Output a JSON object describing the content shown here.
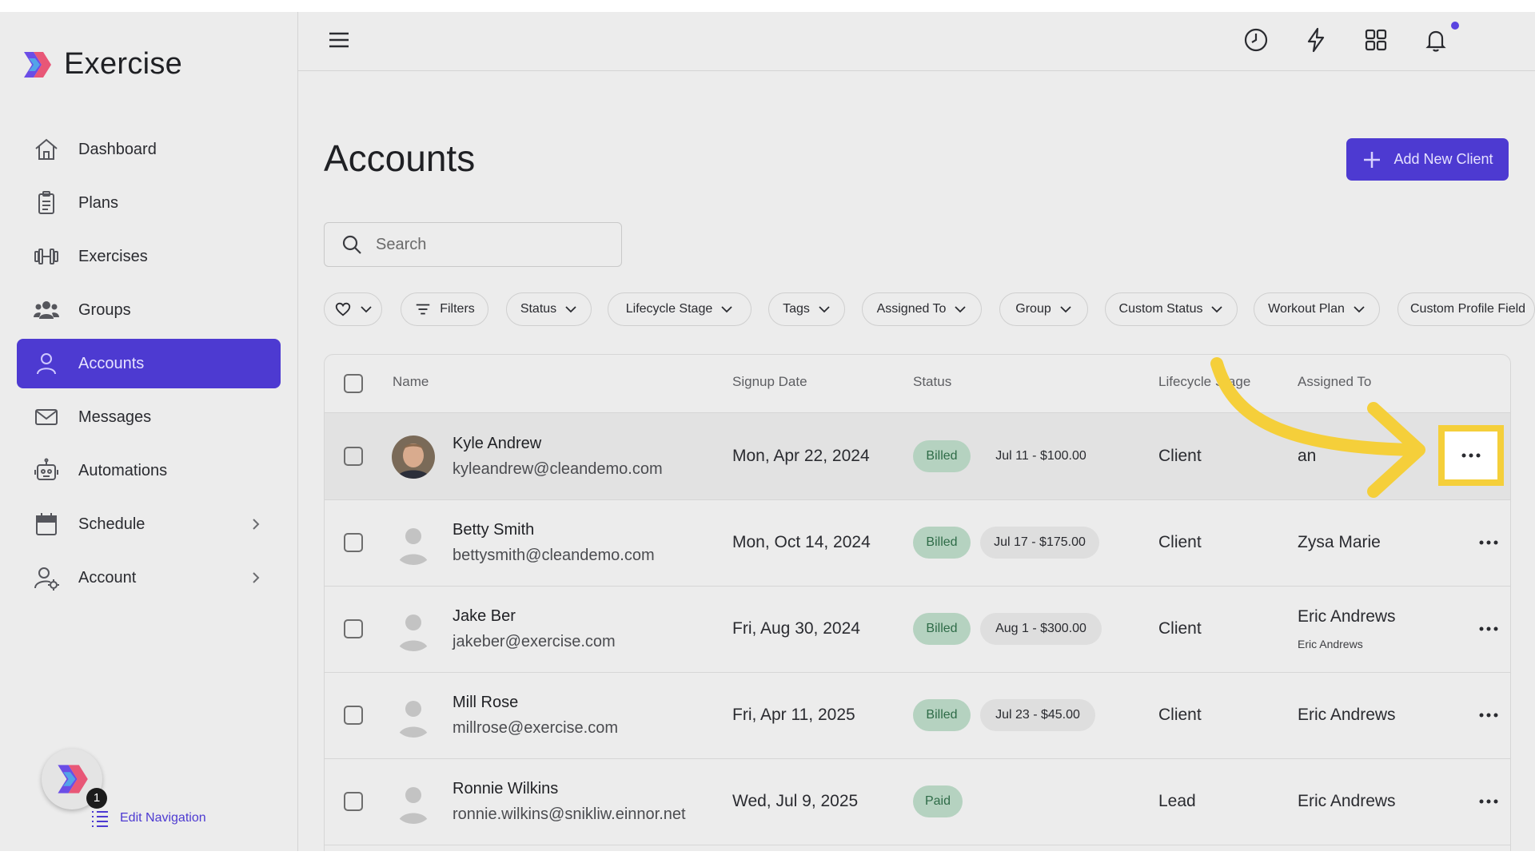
{
  "app": {
    "name": "Exercise"
  },
  "sidebar": {
    "items": [
      {
        "label": "Dashboard",
        "icon": "home-icon",
        "active": false
      },
      {
        "label": "Plans",
        "icon": "clipboard-icon",
        "active": false
      },
      {
        "label": "Exercises",
        "icon": "dumbbell-icon",
        "active": false
      },
      {
        "label": "Groups",
        "icon": "users-icon",
        "active": false
      },
      {
        "label": "Accounts",
        "icon": "user-icon",
        "active": true
      },
      {
        "label": "Messages",
        "icon": "mail-icon",
        "active": false
      },
      {
        "label": "Automations",
        "icon": "robot-icon",
        "active": false
      },
      {
        "label": "Schedule",
        "icon": "calendar-icon",
        "active": false,
        "expandable": true
      },
      {
        "label": "Account",
        "icon": "user-gear-icon",
        "active": false,
        "expandable": true
      }
    ],
    "helper_badge_count": "1",
    "edit_navigation_label": "Edit Navigation"
  },
  "topbar": {
    "icons": [
      "menu-icon",
      "clock-icon",
      "lightning-icon",
      "grid-icon",
      "bell-icon",
      "profile-avatar"
    ],
    "has_notification_dot": true
  },
  "main": {
    "title": "Accounts",
    "add_button_label": "Add New Client",
    "search_placeholder": "Search",
    "filters": [
      "Filters",
      "Status",
      "Lifecycle Stage",
      "Tags",
      "Assigned To",
      "Group",
      "Custom Status",
      "Workout Plan",
      "Custom Profile Field"
    ]
  },
  "table": {
    "columns": [
      "Name",
      "Signup Date",
      "Status",
      "Lifecycle Stage",
      "Assigned To"
    ],
    "rows": [
      {
        "name": "Kyle Andrew",
        "email": "kyleandrew@cleandemo.com",
        "signup": "Mon, Apr 22, 2024",
        "status": "Billed",
        "invoice": "Jul 11 - $100.00",
        "stage": "Client",
        "assigned": "an",
        "assigned_sub": ""
      },
      {
        "name": "Betty Smith",
        "email": "bettysmith@cleandemo.com",
        "signup": "Mon, Oct 14, 2024",
        "status": "Billed",
        "invoice": "Jul 17 - $175.00",
        "stage": "Client",
        "assigned": "Zysa Marie",
        "assigned_sub": ""
      },
      {
        "name": "Jake Ber",
        "email": "jakeber@exercise.com",
        "signup": "Fri, Aug 30, 2024",
        "status": "Billed",
        "invoice": "Aug 1 - $300.00",
        "stage": "Client",
        "assigned": "Eric Andrews",
        "assigned_sub": "Eric Andrews"
      },
      {
        "name": "Mill Rose",
        "email": "millrose@exercise.com",
        "signup": "Fri, Apr 11, 2025",
        "status": "Billed",
        "invoice": "Jul 23 - $45.00",
        "stage": "Client",
        "assigned": "Eric Andrews",
        "assigned_sub": ""
      },
      {
        "name": "Ronnie Wilkins",
        "email": "ronnie.wilkins@snikliw.einnor.net",
        "signup": "Wed, Jul 9, 2025",
        "status": "Paid",
        "invoice": "",
        "stage": "Lead",
        "assigned": "Eric Andrews",
        "assigned_sub": ""
      }
    ]
  },
  "annotation": {
    "color": "#f5cf3a",
    "target": "row-actions-menu"
  },
  "colors": {
    "accent": "#4d3ad1",
    "background": "#ececec",
    "status_green": "#b5d2c0",
    "highlight": "#f5cf3a"
  }
}
